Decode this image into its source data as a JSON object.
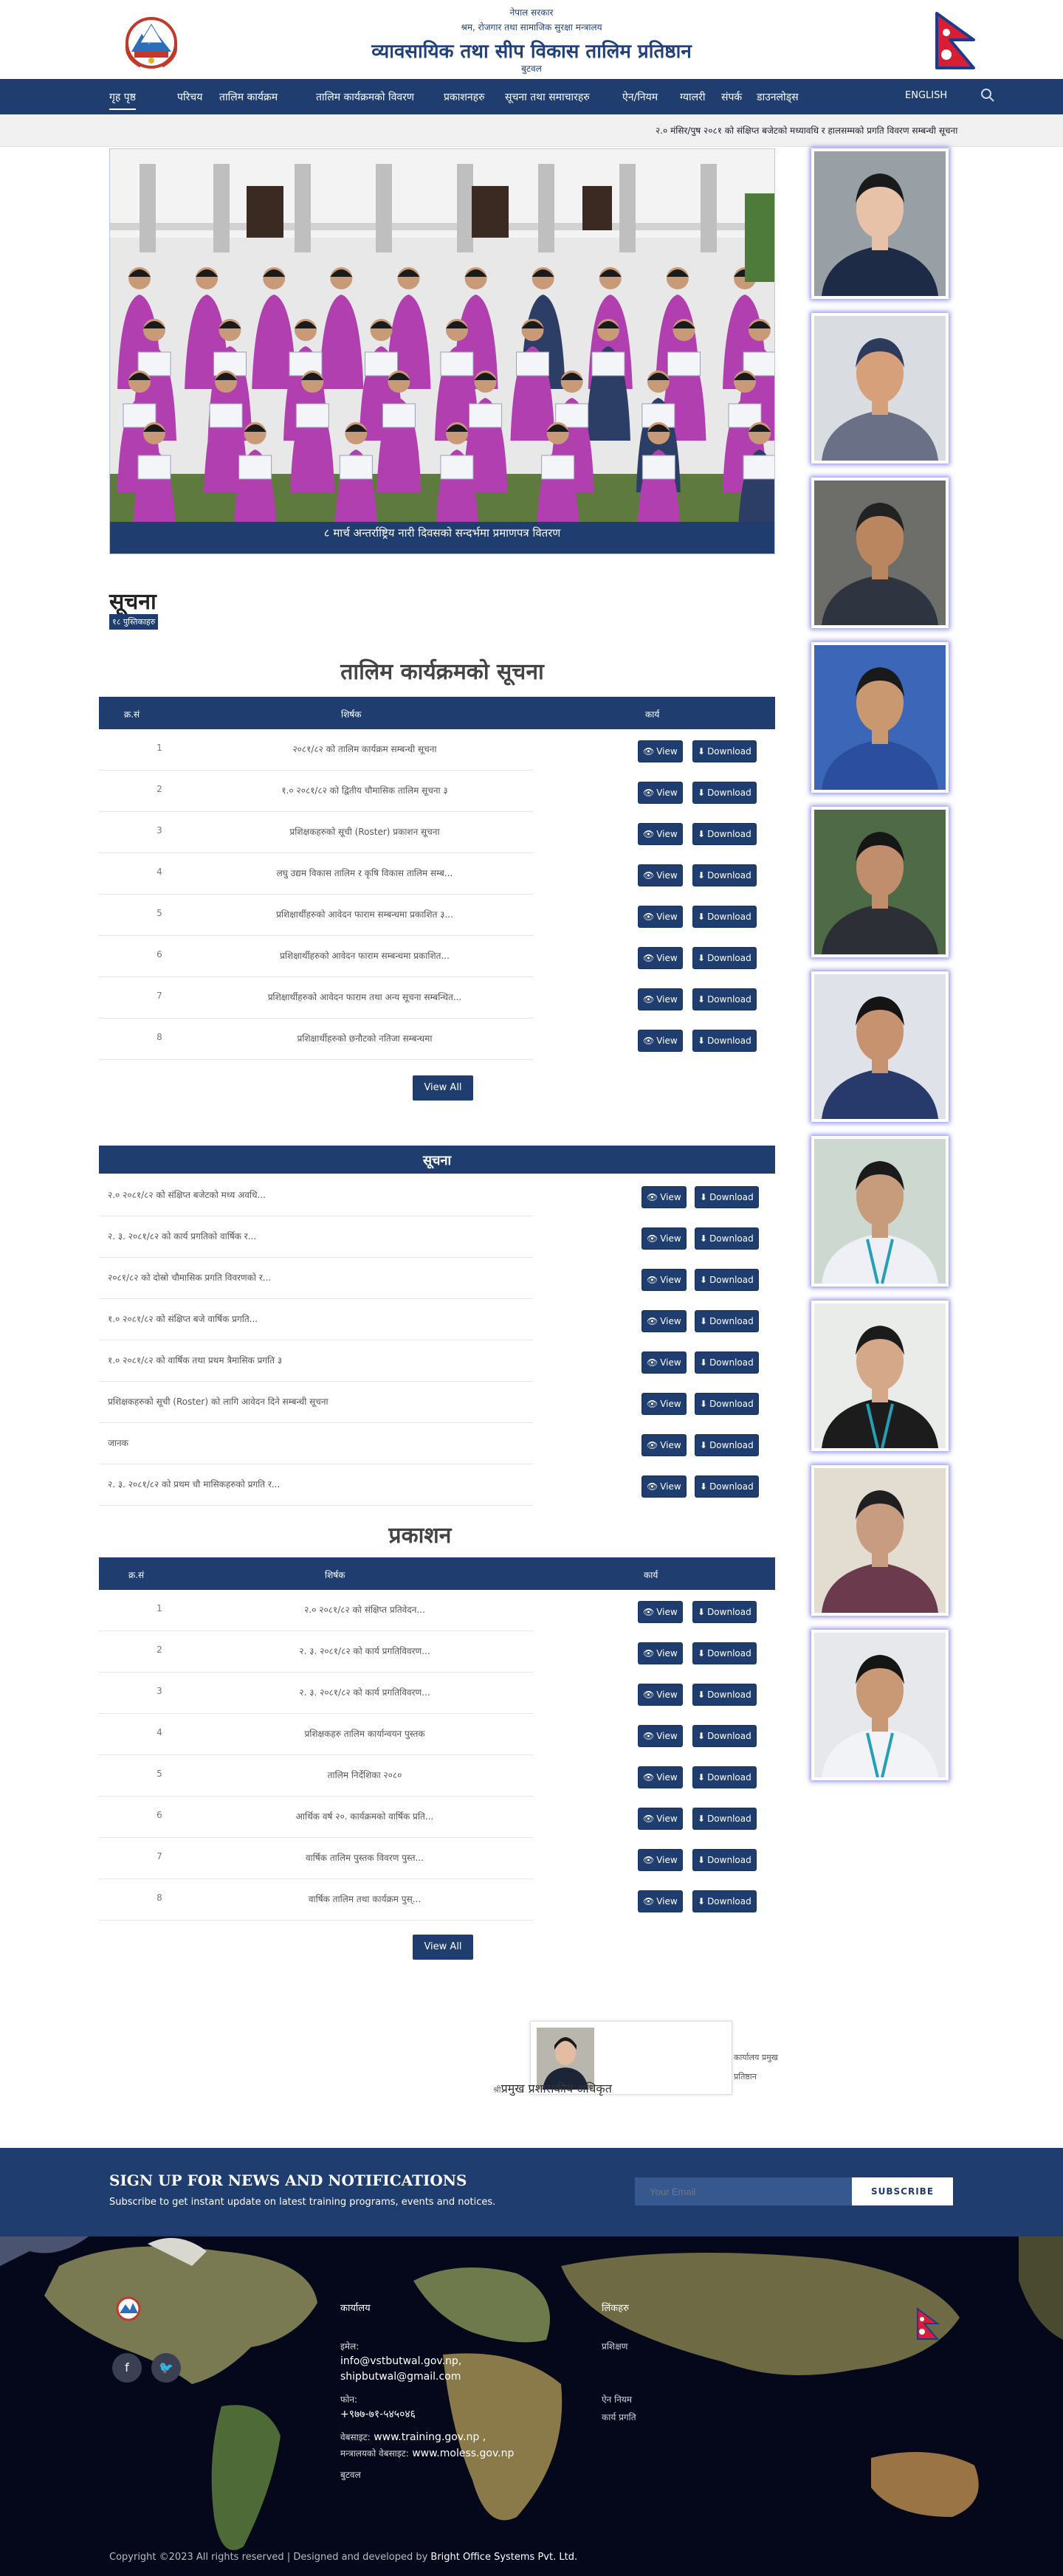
{
  "header": {
    "line1": "नेपाल सरकार",
    "line2": "श्रम, रोजगार तथा सामाजिक सुरक्षा मन्त्रालय",
    "title": "व्यावसायिक तथा सीप विकास तालिम प्रतिष्ठान",
    "location": "बुटवल"
  },
  "nav": {
    "items": [
      {
        "label": "गृह पृष्ठ",
        "active": true
      },
      {
        "label": "परिचय"
      },
      {
        "label": "तालिम कार्यक्रम"
      },
      {
        "label": "तालिम कार्यक्रमको विवरण"
      },
      {
        "label": "प्रकाशनहरु"
      },
      {
        "label": "सूचना तथा समाचारहरु"
      },
      {
        "label": "ऐन/नियम"
      },
      {
        "label": "ग्यालरी"
      },
      {
        "label": "संपर्क"
      },
      {
        "label": "डाउनलोड्स"
      }
    ],
    "language": "ENGLISH"
  },
  "ticker": {
    "text": "२.० मंसिर/पुष २०८१ को संक्षिप्त बजेटको मध्यावधि र हालसम्मको प्रगति विवरण सम्बन्धी सूचना"
  },
  "hero": {
    "caption": "८ मार्च अन्तर्राष्ट्रिय नारी दिवसको सन्दर्भमा प्रमाणपत्र वितरण",
    "colors": {
      "sari": "#b23fb0",
      "building": "#e9e9e9",
      "ground": "#6e8a4a"
    }
  },
  "notices": {
    "heading": "सूचना",
    "tag": "१८ पुस्तिकाहरु"
  },
  "programs": {
    "title": "तालिम कार्यक्रमको सूचना",
    "headers": {
      "sn": "क्र.सं",
      "title": "शिर्षक",
      "action": "कार्य"
    },
    "view_label": "View",
    "download_label": "Download",
    "view_all": "View All",
    "rows": [
      {
        "sn": "1",
        "title": "२०८१/८२ को तालिम कार्यक्रम सम्बन्धी सूचना"
      },
      {
        "sn": "2",
        "title": "१.० २०८१/८२ को द्वितीय चौमासिक तालिम सूचना ३"
      },
      {
        "sn": "3",
        "title": "प्रशिक्षकहरुको सूची (Roster) प्रकाशन सूचना"
      },
      {
        "sn": "4",
        "title": "लघु उद्यम विकास तालिम र कृषि विकास तालिम सम्ब..."
      },
      {
        "sn": "5",
        "title": "प्रशिक्षार्थीहरुको आवेदन फाराम सम्बन्धमा प्रकाशित ३..."
      },
      {
        "sn": "6",
        "title": "प्रशिक्षार्थीहरुको आवेदन फाराम सम्बन्धमा प्रकाशित..."
      },
      {
        "sn": "7",
        "title": "प्रशिक्षार्थीहरुको आवेदन फाराम तथा अन्य सूचना सम्बन्धित..."
      },
      {
        "sn": "8",
        "title": "प्रशिक्षार्थीहरुको छनौटको नतिजा सम्बन्धमा"
      }
    ]
  },
  "news": {
    "band": "सूचना",
    "rows": [
      {
        "title": "२.० २०८१/८२ को संक्षिप्त बजेटको मध्य अवधि..."
      },
      {
        "title": "२. ३. २०८१/८२ को कार्य प्रगतिको वार्षिक र..."
      },
      {
        "title": "२०८१/८२ को दोस्रो चौमासिक प्रगति विवरणको र..."
      },
      {
        "title": "१.० २०८१/८२ को संक्षिप्त बजे वार्षिक प्रगति..."
      },
      {
        "title": "१.० २०८१/८२ को वार्षिक तथा प्रथम त्रैमासिक प्रगति ३"
      },
      {
        "title": "प्रशिक्षकहरुको सूची (Roster) को लागि आवेदन दिने सम्बन्धी सूचना"
      },
      {
        "title": "जानक"
      },
      {
        "title": "२. ३. २०८१/८२ को प्रथम चौ मासिकहरुको प्रगति र..."
      }
    ]
  },
  "publications": {
    "title": "प्रकाशन",
    "headers": {
      "sn": "क्र.सं",
      "title": "शिर्षक",
      "action": "कार्य"
    },
    "rows": [
      {
        "sn": "1",
        "title": "२.० २०८१/८२ को संक्षिप्त प्रतिवेदन..."
      },
      {
        "sn": "2",
        "title": "२. ३. २०८१/८२ को कार्य प्रगतिविवरण..."
      },
      {
        "sn": "3",
        "title": "२. ३. २०८१/८२ को कार्य प्रगतिविवरण..."
      },
      {
        "sn": "4",
        "title": "प्रशिक्षकहरु तालिम कार्यान्वयन पुस्तक"
      },
      {
        "sn": "5",
        "title": "तालिम निर्देशिका २०८०"
      },
      {
        "sn": "6",
        "title": "आर्थिक वर्ष २०. कार्यक्रमको वार्षिक प्रति..."
      },
      {
        "sn": "7",
        "title": "वार्षिक तालिम पुस्तक विवरण पुस्त..."
      },
      {
        "sn": "8",
        "title": "वार्षिक तालिम तथा कार्यक्रम पुस्..."
      }
    ]
  },
  "staff_card": {
    "name": "प्रमुख प्रशासकीय अधिकृत",
    "name_prefix": "श्री",
    "side_line1": "कार्यालय प्रमुख",
    "side_line2": "प्रतिष्ठान"
  },
  "sidebar_photos": [
    {
      "shirt": "#1d2b46",
      "skin": "#e8c2a8",
      "bg": "#98a0a6",
      "hair": "#1a1a1a",
      "lanyard": ""
    },
    {
      "shirt": "#6a7086",
      "skin": "#d6a07a",
      "bg": "#d9dde2",
      "hair": "#2c3a5c",
      "lanyard": ""
    },
    {
      "shirt": "#2e3440",
      "skin": "#b98660",
      "bg": "#6d6e6a",
      "hair": "#222222",
      "lanyard": ""
    },
    {
      "shirt": "#2b4f9e",
      "skin": "#c99770",
      "bg": "#3c66b8",
      "hair": "#1a1a1a",
      "lanyard": ""
    },
    {
      "shirt": "#2c2f36",
      "skin": "#c08e6c",
      "bg": "#4f6a46",
      "hair": "#161616",
      "lanyard": ""
    },
    {
      "shirt": "#283a6c",
      "skin": "#c79270",
      "bg": "#dfe2e8",
      "hair": "#141414",
      "lanyard": ""
    },
    {
      "shirt": "#eef0f6",
      "skin": "#c69c7c",
      "bg": "#cdd8d0",
      "hair": "#1a1a1a",
      "lanyard": "#23a0b8"
    },
    {
      "shirt": "#1c1c1c",
      "skin": "#d5a88a",
      "bg": "#e9ece9",
      "hair": "#1b1b1b",
      "lanyard": "#23a0b8"
    },
    {
      "shirt": "#6b3a4c",
      "skin": "#c89c80",
      "bg": "#e3dcd0",
      "hair": "#1f1f1f",
      "lanyard": ""
    },
    {
      "shirt": "#f2f3f6",
      "skin": "#c99874",
      "bg": "#e6e8ec",
      "hair": "#151515",
      "lanyard": "#23a0b8"
    }
  ],
  "newsletter": {
    "title": "SIGN UP FOR NEWS AND NOTIFICATIONS",
    "subtitle": "Subscribe to get instant update on latest training programs, events and notices.",
    "input_placeholder": "Your Email",
    "button": "SUBSCRIBE"
  },
  "footer": {
    "col_office": "कार्यालय",
    "email_label": "इमेल:",
    "email1": "info@vstbutwal.gov.np,",
    "email2": "shipbutwal@gmail.com",
    "phone_label": "फोन:",
    "phone": "+९७७-७१-५४५०४६",
    "web_label": "वेबसाइट:",
    "web1": "www.training.gov.np ,",
    "web_label2": "मन्त्रालयको वेबसाइट:",
    "web2": "www.moless.gov.np",
    "address": "बुटवल",
    "col_links": "लिंकहरु",
    "link1": "प्रशिक्षण",
    "link2": "ऐन नियम",
    "link3": "कार्य प्रगति",
    "copyright_prefix": "Copyright ©2023 All rights reserved | Designed and developed by ",
    "copyright_company": "Bright Office Systems Pvt. Ltd."
  }
}
